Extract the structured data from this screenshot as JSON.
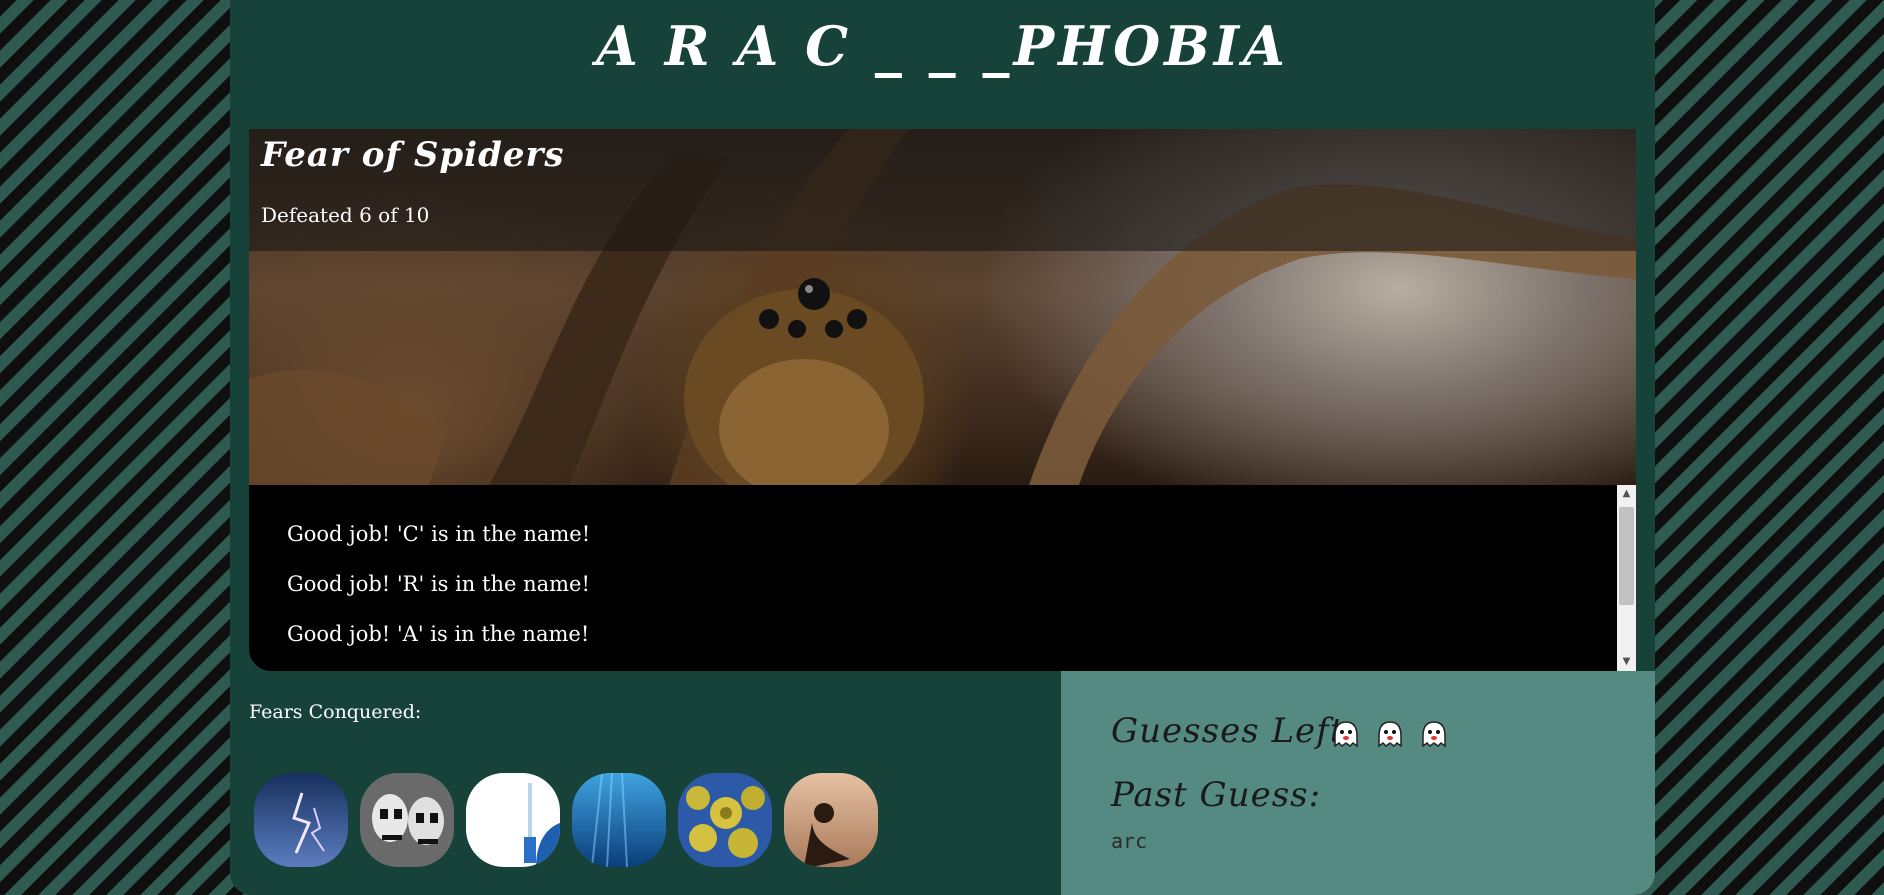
{
  "header": {
    "title": "A R A C _ _ _PHOBIA"
  },
  "phobia": {
    "title": "Fear of Spiders",
    "progress_text": "Defeated 6 of 10",
    "defeated": 6,
    "total": 10
  },
  "messages": [
    "Good job! 'C' is in the name!",
    "Good job! 'R' is in the name!",
    "Good job! 'A' is in the name!"
  ],
  "conquered": {
    "label": "Fears Conquered:",
    "icons": [
      "lightning-storm",
      "clown-faces",
      "syringe",
      "deep-water",
      "germs",
      "loneliness"
    ]
  },
  "guesses": {
    "left_label": "Guesses Left:",
    "remaining": 3,
    "past_label": "Past Guess:",
    "past_value": "arc"
  }
}
